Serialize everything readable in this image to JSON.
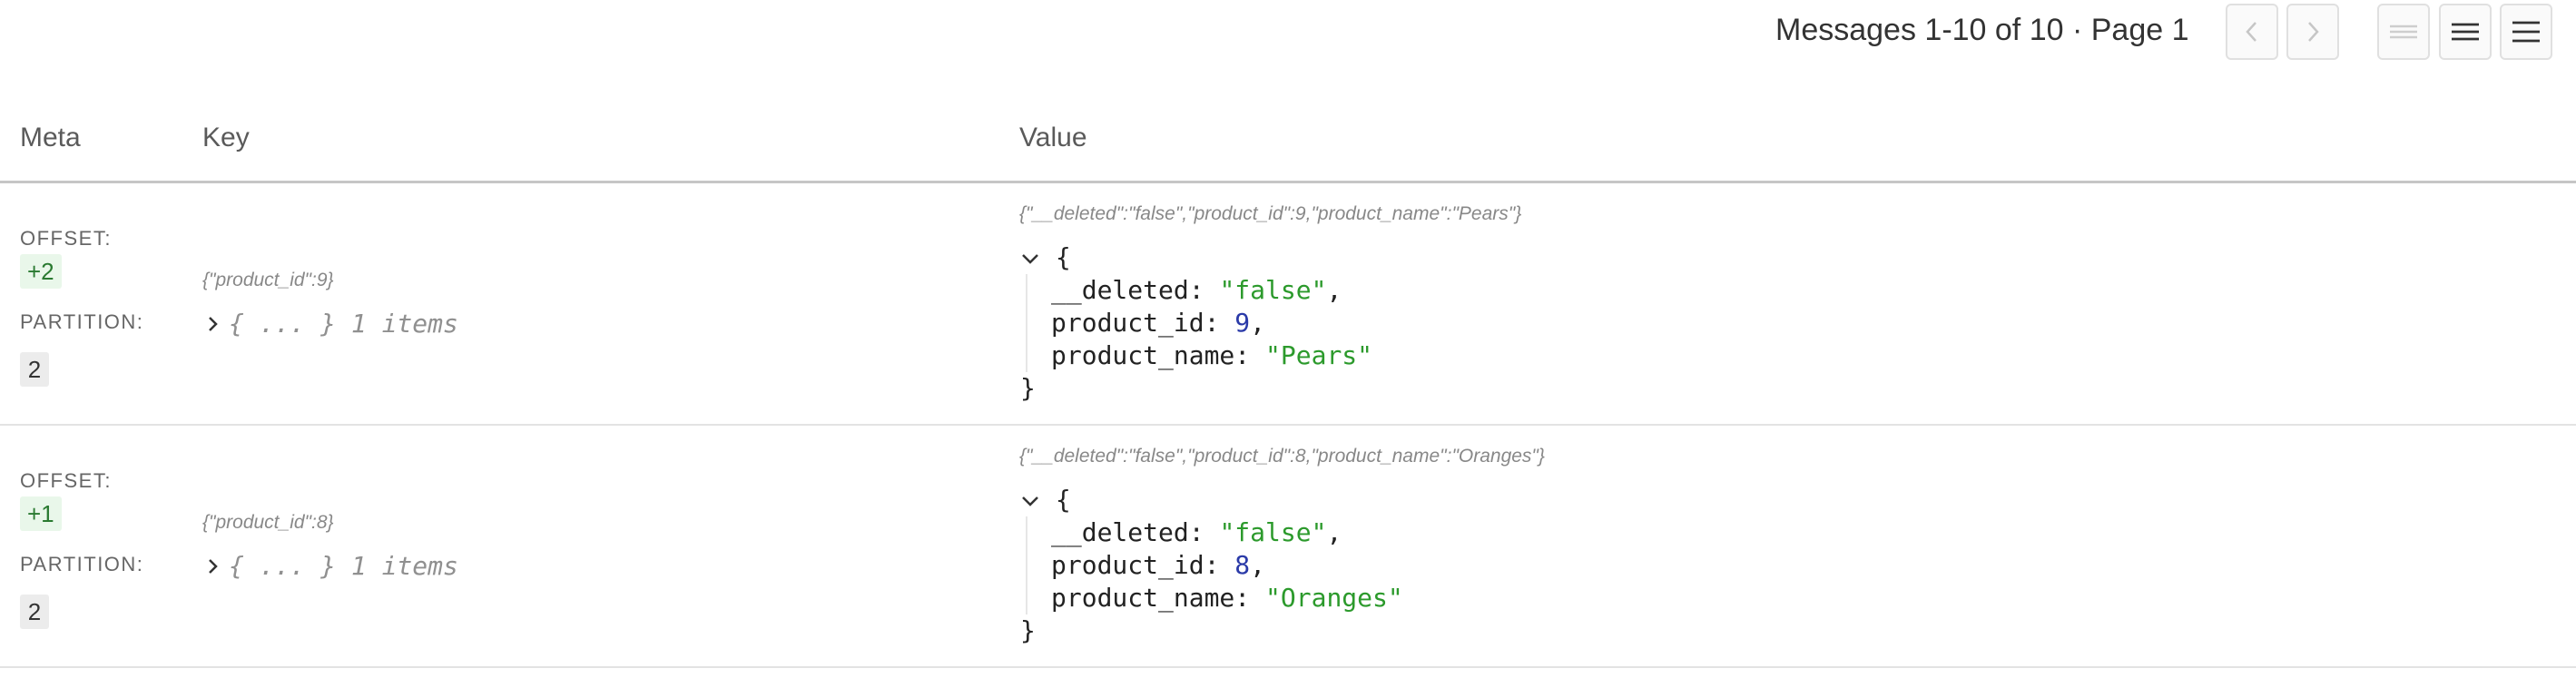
{
  "toolbar": {
    "paging_text": "Messages 1-10 of 10 · Page 1",
    "prev_icon": "chevron-left-icon",
    "next_icon": "chevron-right-icon",
    "density_icons": [
      "density-compact-icon",
      "density-medium-icon",
      "density-comfortable-icon"
    ]
  },
  "columns": {
    "meta": "Meta",
    "key": "Key",
    "value": "Value"
  },
  "labels": {
    "offset": "OFFSET:",
    "partition": "PARTITION:"
  },
  "messages": [
    {
      "offset": "+2",
      "partition": "2",
      "key_raw": "{\"product_id\":9}",
      "key_collapsed": "{ ... } 1 items",
      "value_raw": "{\"__deleted\":\"false\",\"product_id\":9,\"product_name\":\"Pears\"}",
      "open_brace": "{",
      "close_brace": "}",
      "fields": [
        {
          "key": "__deleted: ",
          "value": "\"false\"",
          "comma": ","
        },
        {
          "key": "product_id: ",
          "value": "9",
          "comma": ","
        },
        {
          "key": "product_name: ",
          "value": "\"Pears\"",
          "comma": ""
        }
      ]
    },
    {
      "offset": "+1",
      "partition": "2",
      "key_raw": "{\"product_id\":8}",
      "key_collapsed": "{ ... } 1 items",
      "value_raw": "{\"__deleted\":\"false\",\"product_id\":8,\"product_name\":\"Oranges\"}",
      "open_brace": "{",
      "close_brace": "}",
      "fields": [
        {
          "key": "__deleted: ",
          "value": "\"false\"",
          "comma": ","
        },
        {
          "key": "product_id: ",
          "value": "8",
          "comma": ","
        },
        {
          "key": "product_name: ",
          "value": "\"Oranges\"",
          "comma": ""
        }
      ]
    }
  ],
  "colors": {
    "string": "#2c9a2c",
    "number": "#2a3aa8",
    "offset_badge_bg": "#e9f7ea"
  }
}
